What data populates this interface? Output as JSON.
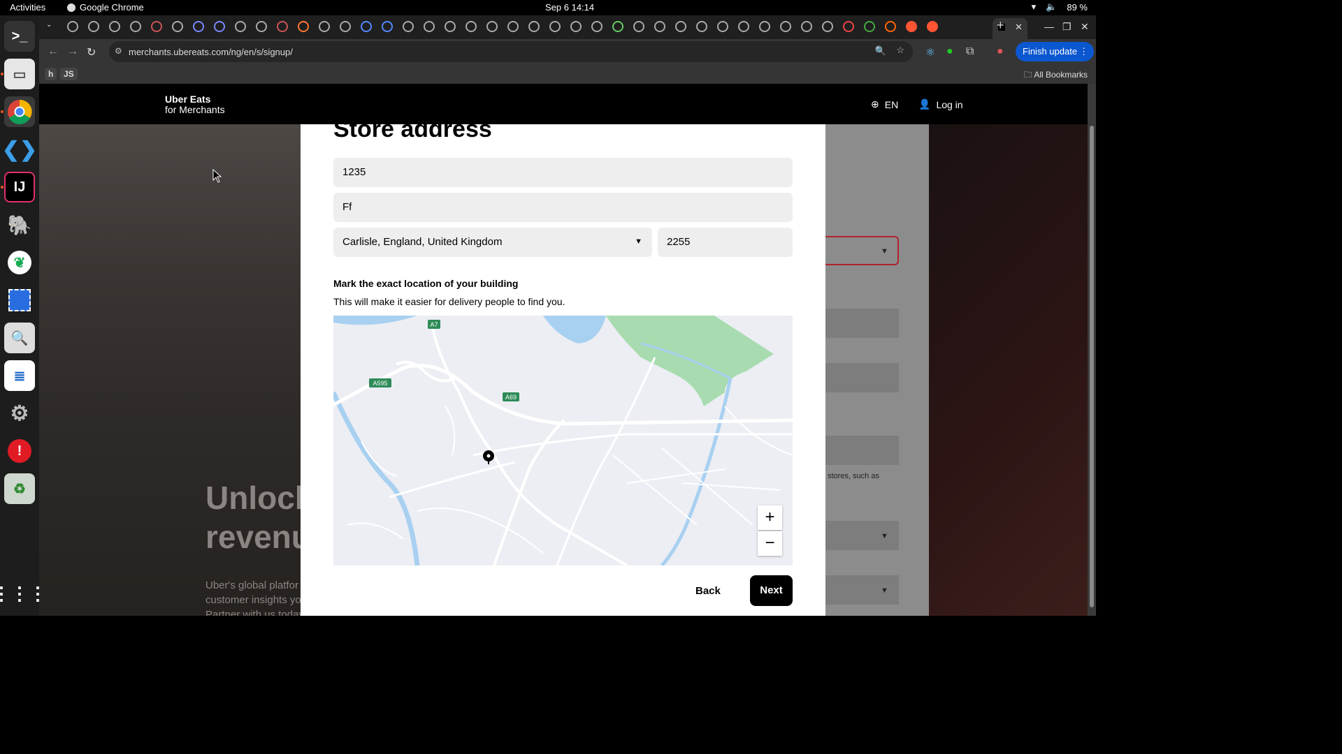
{
  "system": {
    "activities": "Activities",
    "app_name": "Google Chrome",
    "clock": "Sep 6  14:14",
    "battery": "89 %"
  },
  "browser": {
    "url": "merchants.ubereats.com/ng/en/s/signup/",
    "finish_update": "Finish update",
    "bookmarks": [
      "h",
      "JS"
    ],
    "all_bookmarks": "All Bookmarks"
  },
  "site": {
    "logo_line1": "Uber Eats",
    "logo_line2": "for Merchants",
    "language": "EN",
    "login": "Log in",
    "bg_headline_1": "Unlock",
    "bg_headline_2": "revenu",
    "bg_copy_1": "Uber's global platfor",
    "bg_copy_2": "customer insights yo",
    "bg_copy_3": "Partner with us today",
    "bg_right_text": "stores, such as"
  },
  "form": {
    "title": "Store address",
    "street_number": "1235",
    "street_name": "Ff",
    "city": "Carlisle, England, United Kingdom",
    "postcode": "2255",
    "mark_title": "Mark the exact location of your building",
    "mark_subtitle": "This will make it easier for delivery people to find you.",
    "back_label": "Back",
    "next_label": "Next"
  },
  "map": {
    "road_labels": [
      "A7",
      "A595",
      "A69"
    ],
    "zoom_in": "+",
    "zoom_out": "−",
    "water_color": "#a8d0f0",
    "park_color": "#a8dcb0"
  }
}
